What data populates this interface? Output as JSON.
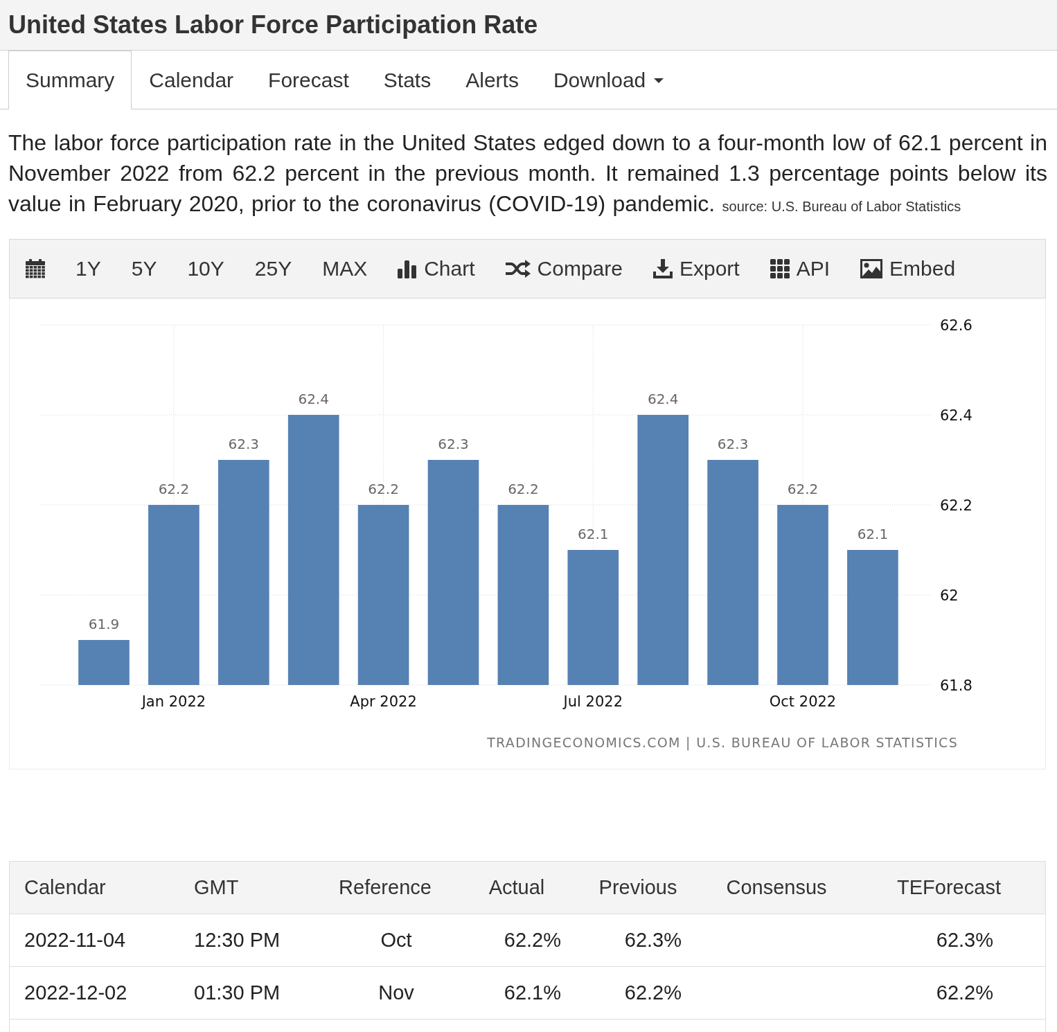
{
  "page": {
    "title": "United States Labor Force Participation Rate"
  },
  "tabs": [
    {
      "label": "Summary",
      "selected": true
    },
    {
      "label": "Calendar",
      "selected": false
    },
    {
      "label": "Forecast",
      "selected": false
    },
    {
      "label": "Stats",
      "selected": false
    },
    {
      "label": "Alerts",
      "selected": false
    },
    {
      "label": "Download",
      "selected": false,
      "dropdown": true
    }
  ],
  "summary": {
    "text": "The labor force participation rate in the United States edged down to a four-month low of 62.1 percent in November 2022 from 62.2 percent in the previous month. It remained 1.3 percentage points below its value in February 2020, prior to the coronavirus (COVID-19) pandemic.",
    "source": "source: U.S. Bureau of Labor Statistics"
  },
  "toolbar": [
    {
      "kind": "date"
    },
    {
      "kind": "range",
      "label": "1Y"
    },
    {
      "kind": "range",
      "label": "5Y"
    },
    {
      "kind": "range",
      "label": "10Y"
    },
    {
      "kind": "range",
      "label": "25Y"
    },
    {
      "kind": "range",
      "label": "MAX"
    },
    {
      "kind": "chart",
      "label": "Chart"
    },
    {
      "kind": "compare",
      "label": "Compare"
    },
    {
      "kind": "export",
      "label": "Export"
    },
    {
      "kind": "api",
      "label": "API"
    },
    {
      "kind": "embed",
      "label": "Embed"
    }
  ],
  "chart": {
    "chart_data": {
      "type": "bar",
      "categories": [
        null,
        "Jan 2022",
        null,
        null,
        "Apr 2022",
        null,
        null,
        "Jul 2022",
        null,
        null,
        "Oct 2022",
        null
      ],
      "series": [
        {
          "color": "#5681b3",
          "values": [
            61.9,
            62.2,
            62.3,
            62.4,
            62.2,
            62.3,
            62.2,
            62.1,
            62.4,
            62.3,
            62.2,
            62.1
          ]
        }
      ],
      "ylim": [
        61.8,
        62.6
      ],
      "yticks": [
        61.8,
        62,
        62.2,
        62.4,
        62.6
      ],
      "grid": true,
      "data_labels": true
    },
    "credits": "TRADINGECONOMICS.COM | U.S. BUREAU OF LABOR STATISTICS"
  },
  "table": {
    "columns": [
      "Calendar",
      "GMT",
      "Reference",
      "Actual",
      "Previous",
      "Consensus",
      "TEForecast"
    ],
    "rows": [
      {
        "cells": [
          "2022-11-04",
          "12:30 PM",
          "Oct",
          "62.2%",
          "62.3%",
          null,
          "62.3%"
        ]
      },
      {
        "cells": [
          "2022-12-02",
          "01:30 PM",
          "Nov",
          "62.1%",
          "62.2%",
          null,
          "62.2%"
        ]
      }
    ]
  }
}
